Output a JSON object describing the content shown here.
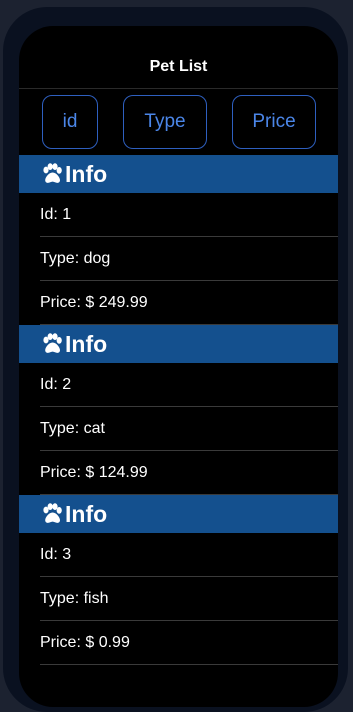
{
  "nav": {
    "title": "Pet List"
  },
  "sort": {
    "buttons": [
      {
        "label": "id"
      },
      {
        "label": "Type"
      },
      {
        "label": "Price"
      }
    ]
  },
  "pets": [
    {
      "header": "Info",
      "id_prefix": "Id:",
      "id": "1",
      "type_prefix": "Type:",
      "type": "dog",
      "price_prefix": "Price: $",
      "price": "249.99"
    },
    {
      "header": "Info",
      "id_prefix": "Id:",
      "id": "2",
      "type_prefix": "Type:",
      "type": "cat",
      "price_prefix": "Price: $",
      "price": "124.99"
    },
    {
      "header": "Info",
      "id_prefix": "Id:",
      "id": "3",
      "type_prefix": "Type:",
      "type": "fish",
      "price_prefix": "Price: $",
      "price": "0.99"
    }
  ],
  "colors": {
    "header_bg": "#14508e",
    "button_text": "#4b86e8",
    "button_border": "#2e5fbf",
    "background": "#000000"
  },
  "icons": {
    "card_icon": "paw-icon"
  }
}
